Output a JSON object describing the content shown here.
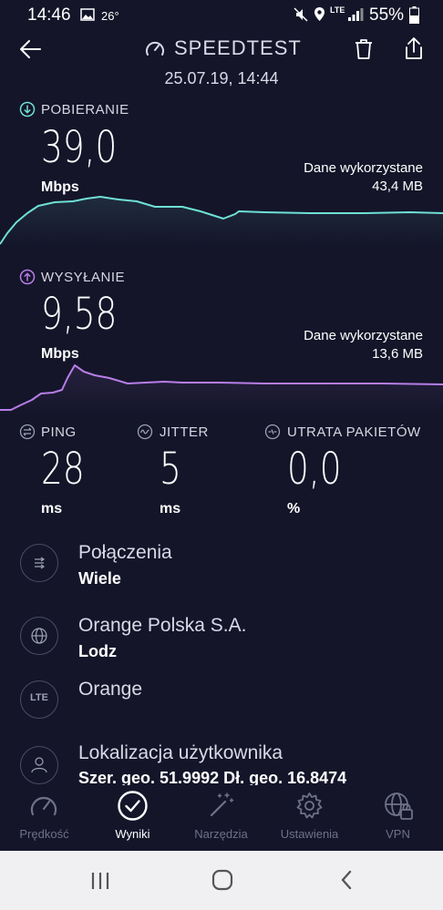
{
  "status_bar": {
    "time": "14:46",
    "temperature": "26°",
    "network": "LTE",
    "battery": "55%"
  },
  "header": {
    "title": "SPEEDTEST",
    "date": "25.07.19, 14:44"
  },
  "download": {
    "label": "POBIERANIE",
    "value": "39,0",
    "unit": "Mbps",
    "data_used_label": "Dane wykorzystane",
    "data_used_value": "43,4 MB",
    "color": "#6fe0d6"
  },
  "upload": {
    "label": "WYSYŁANIE",
    "value": "9,58",
    "unit": "Mbps",
    "data_used_label": "Dane wykorzystane",
    "data_used_value": "13,6 MB",
    "color": "#b77ee8"
  },
  "metrics": [
    {
      "label": "PING",
      "value": "28",
      "unit": "ms",
      "icon": "ping-icon"
    },
    {
      "label": "JITTER",
      "value": "5",
      "unit": "ms",
      "icon": "jitter-icon"
    },
    {
      "label": "UTRATA PAKIETÓW",
      "value": "0,0",
      "unit": "%",
      "icon": "packet-loss-icon"
    }
  ],
  "details": [
    {
      "title": "Połączenia",
      "subtitle": "Wiele",
      "icon": "connections-icon"
    },
    {
      "title": "Orange Polska S.A.",
      "subtitle": "Lodz",
      "icon": "globe-icon"
    },
    {
      "title": "Orange",
      "subtitle": "",
      "icon": "lte-icon",
      "icon_text": "LTE"
    },
    {
      "title": "Lokalizacja użytkownika",
      "subtitle": "Szer. geo. 51.9992 Dł. geo. 16.8474",
      "icon": "user-icon"
    }
  ],
  "bottom_nav": [
    {
      "label": "Prędkość",
      "icon": "speedometer-icon",
      "active": false
    },
    {
      "label": "Wyniki",
      "icon": "check-circle-icon",
      "active": true
    },
    {
      "label": "Narzędzia",
      "icon": "magic-wand-icon",
      "active": false
    },
    {
      "label": "Ustawienia",
      "icon": "gear-icon",
      "active": false
    },
    {
      "label": "VPN",
      "icon": "vpn-globe-lock-icon",
      "active": false
    }
  ]
}
